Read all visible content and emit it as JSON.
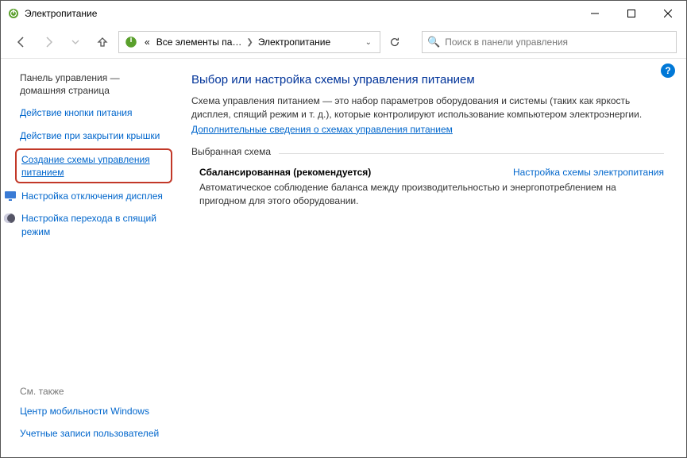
{
  "titlebar": {
    "title": "Электропитание"
  },
  "nav": {
    "crumb_prefix": "«",
    "crumb1": "Все элементы па…",
    "crumb2": "Электропитание"
  },
  "search": {
    "placeholder": "Поиск в панели управления"
  },
  "sidebar": {
    "home": "Панель управления — домашняя страница",
    "link_power_button": "Действие кнопки питания",
    "link_lid": "Действие при закрытии крышки",
    "link_create_plan": "Создание схемы управления питанием",
    "link_display_off": "Настройка отключения дисплея",
    "link_sleep": "Настройка перехода в спящий режим",
    "seealso_title": "См. также",
    "seealso1": "Центр мобильности Windows",
    "seealso2": "Учетные записи пользователей"
  },
  "main": {
    "heading": "Выбор или настройка схемы управления питанием",
    "description": "Схема управления питанием — это набор параметров оборудования и системы (таких как яркость дисплея, спящий режим и т. д.), которые контролируют использование компьютером электроэнергии.",
    "more_link": "Дополнительные сведения о схемах управления питанием",
    "fieldset_label": "Выбранная схема",
    "plan": {
      "name": "Сбалансированная (рекомендуется)",
      "settings_link": "Настройка схемы электропитания",
      "desc": "Автоматическое соблюдение баланса между производительностью и энергопотреблением на пригодном для этого оборудовании."
    }
  }
}
